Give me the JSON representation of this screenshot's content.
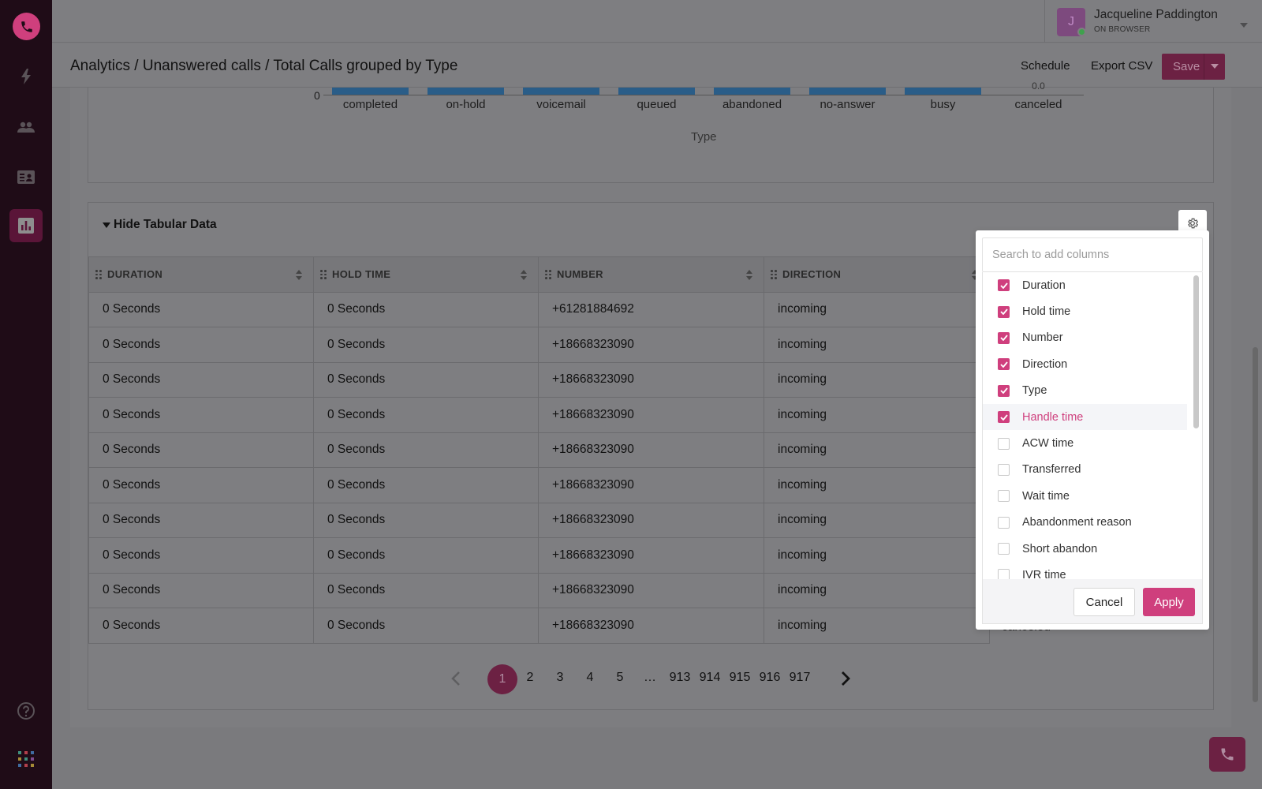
{
  "app": {
    "accent_color": "#cf3f7d",
    "sidebar_items": [
      {
        "name": "dialer",
        "icon": "phone-icon"
      },
      {
        "name": "activity",
        "icon": "lightning-icon"
      },
      {
        "name": "contacts",
        "icon": "people-icon"
      },
      {
        "name": "cards",
        "icon": "id-card-icon"
      },
      {
        "name": "analytics",
        "icon": "bar-chart-icon",
        "active": true
      }
    ]
  },
  "user": {
    "initial": "J",
    "name": "Jacqueline Paddington",
    "status": "ON BROWSER"
  },
  "header": {
    "title": "Analytics / Unanswered calls / Total Calls grouped by Type",
    "schedule_label": "Schedule",
    "export_label": "Export CSV",
    "save_label": "Save"
  },
  "chart_data": {
    "type": "bar",
    "categories": [
      "completed",
      "on-hold",
      "voicemail",
      "queued",
      "abandoned",
      "no-answer",
      "busy",
      "canceled"
    ],
    "values": [
      null,
      null,
      null,
      null,
      null,
      null,
      null,
      0.0
    ],
    "value_labels": [
      "",
      "",
      "",
      "",
      "",
      "",
      "",
      "0.0"
    ],
    "xlabel": "Type",
    "y_tick_visible": "0"
  },
  "table": {
    "toggle_label": "Hide Tabular Data",
    "columns": [
      "DURATION",
      "HOLD TIME",
      "NUMBER",
      "DIRECTION"
    ],
    "rows": [
      [
        "0 Seconds",
        "0 Seconds",
        "+61281884692",
        "incoming"
      ],
      [
        "0 Seconds",
        "0 Seconds",
        "+18668323090",
        "incoming"
      ],
      [
        "0 Seconds",
        "0 Seconds",
        "+18668323090",
        "incoming"
      ],
      [
        "0 Seconds",
        "0 Seconds",
        "+18668323090",
        "incoming"
      ],
      [
        "0 Seconds",
        "0 Seconds",
        "+18668323090",
        "incoming"
      ],
      [
        "0 Seconds",
        "0 Seconds",
        "+18668323090",
        "incoming"
      ],
      [
        "0 Seconds",
        "0 Seconds",
        "+18668323090",
        "incoming"
      ],
      [
        "0 Seconds",
        "0 Seconds",
        "+18668323090",
        "incoming"
      ],
      [
        "0 Seconds",
        "0 Seconds",
        "+18668323090",
        "incoming"
      ],
      [
        "0 Seconds",
        "0 Seconds",
        "+18668323090",
        "incoming"
      ]
    ],
    "partial_last_cell": "canceled"
  },
  "pagination": {
    "current": "1",
    "pages": [
      "2",
      "3",
      "4",
      "5",
      "…",
      "913",
      "914",
      "915",
      "916",
      "917"
    ]
  },
  "column_picker": {
    "search_placeholder": "Search to add columns",
    "items": [
      {
        "label": "Duration",
        "checked": true
      },
      {
        "label": "Hold time",
        "checked": true
      },
      {
        "label": "Number",
        "checked": true
      },
      {
        "label": "Direction",
        "checked": true
      },
      {
        "label": "Type",
        "checked": true
      },
      {
        "label": "Handle time",
        "checked": true,
        "highlighted": true
      },
      {
        "label": "ACW time",
        "checked": false
      },
      {
        "label": "Transferred",
        "checked": false
      },
      {
        "label": "Wait time",
        "checked": false
      },
      {
        "label": "Abandonment reason",
        "checked": false
      },
      {
        "label": "Short abandon",
        "checked": false
      },
      {
        "label": "IVR time",
        "checked": false
      }
    ],
    "cancel_label": "Cancel",
    "apply_label": "Apply"
  }
}
